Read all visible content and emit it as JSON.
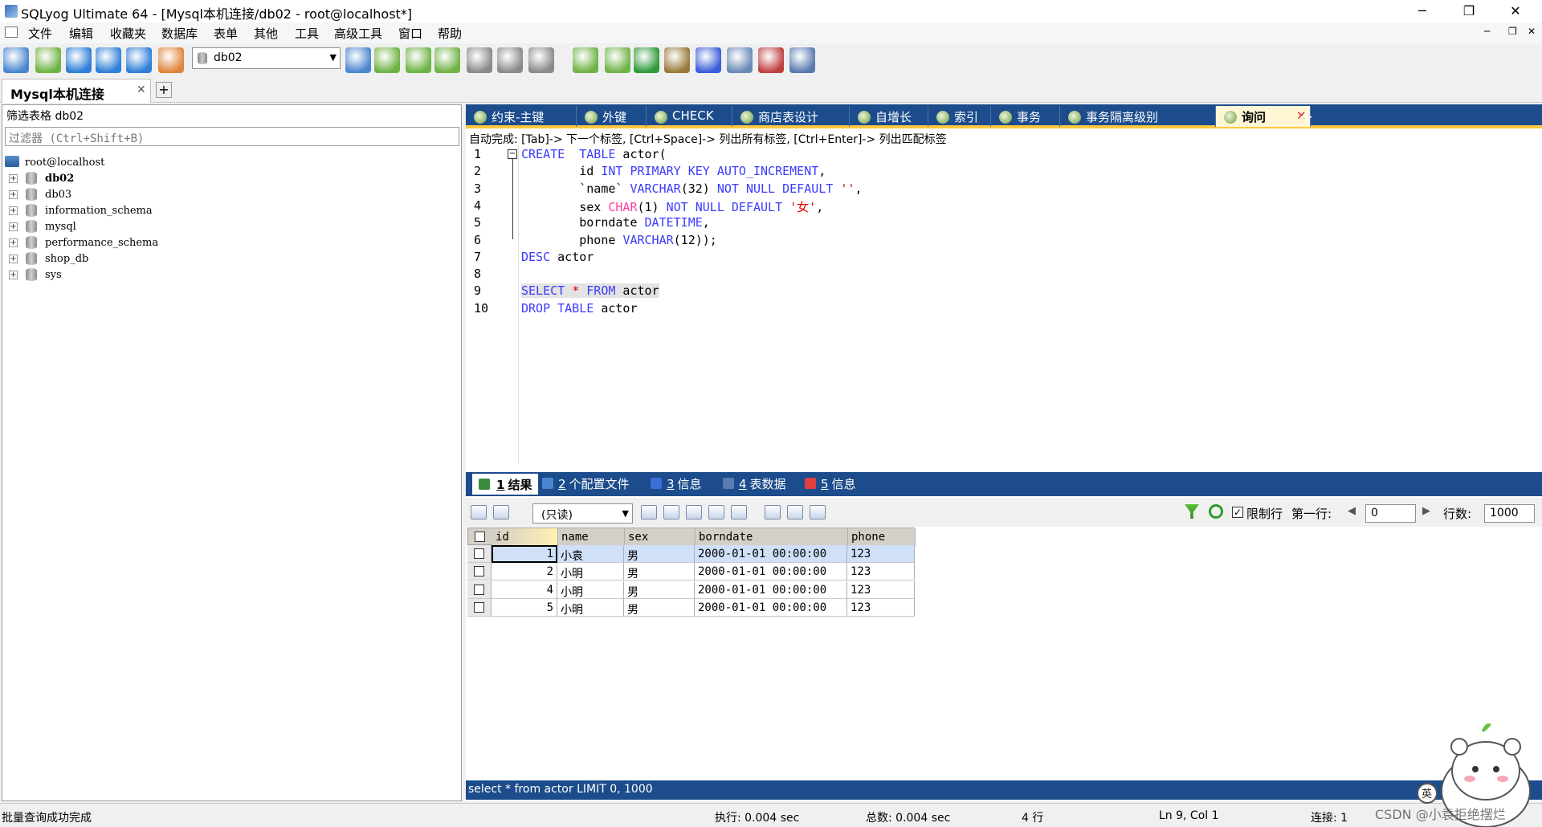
{
  "window": {
    "title": "SQLyog Ultimate 64 - [Mysql本机连接/db02 - root@localhost*]"
  },
  "menu": [
    "文件",
    "编辑",
    "收藏夹",
    "数据库",
    "表单",
    "其他",
    "工具",
    "高级工具",
    "窗口",
    "帮助"
  ],
  "toolbar": {
    "database": "db02"
  },
  "connection_tab": {
    "label": "Mysql本机连接"
  },
  "object_browser": {
    "filter_label": "筛选表格 db02",
    "filter_placeholder": "过滤器 (Ctrl+Shift+B)",
    "root": "root@localhost",
    "databases": [
      "db02",
      "db03",
      "information_schema",
      "mysql",
      "performance_schema",
      "shop_db",
      "sys"
    ],
    "selected": "db02"
  },
  "query_tabs": [
    "约束-主键",
    "外键",
    "CHECK",
    "商店表设计",
    "自增长",
    "索引",
    "事务",
    "事务隔离级别",
    "询问"
  ],
  "active_query_tab": "询问",
  "autocomplete_hint": "自动完成: [Tab]-> 下一个标签, [Ctrl+Space]-> 列出所有标签, [Ctrl+Enter]-> 列出匹配标签",
  "editor": {
    "line_numbers": [
      "1",
      "2",
      "3",
      "4",
      "5",
      "6",
      "7",
      "8",
      "9",
      "10"
    ],
    "lines": [
      [
        [
          "kw",
          "CREATE"
        ],
        [
          "",
          "  "
        ],
        [
          "kw",
          "TABLE"
        ],
        [
          "",
          " actor("
        ]
      ],
      [
        [
          "",
          "        id "
        ],
        [
          "kw",
          "INT"
        ],
        [
          "",
          " "
        ],
        [
          "kw",
          "PRIMARY KEY AUTO_INCREMENT"
        ],
        [
          "",
          ","
        ]
      ],
      [
        [
          "",
          "        `name` "
        ],
        [
          "kw",
          "VARCHAR"
        ],
        [
          "",
          "(32) "
        ],
        [
          "kw",
          "NOT NULL DEFAULT"
        ],
        [
          "",
          " "
        ],
        [
          "str",
          "''"
        ],
        [
          "",
          ","
        ]
      ],
      [
        [
          "",
          "        sex "
        ],
        [
          "chr",
          "CHAR"
        ],
        [
          "",
          "(1) "
        ],
        [
          "kw",
          "NOT NULL DEFAULT"
        ],
        [
          "",
          " "
        ],
        [
          "str",
          "'女'"
        ],
        [
          "",
          ","
        ]
      ],
      [
        [
          "",
          "        borndate "
        ],
        [
          "kw",
          "DATETIME"
        ],
        [
          "",
          ","
        ]
      ],
      [
        [
          "",
          "        phone "
        ],
        [
          "kw",
          "VARCHAR"
        ],
        [
          "",
          "(12));"
        ]
      ],
      [
        [
          "kw",
          "DESC"
        ],
        [
          "",
          " actor"
        ]
      ],
      [
        [
          "",
          ""
        ]
      ],
      [
        [
          "kw",
          "SELECT"
        ],
        [
          "",
          " "
        ],
        [
          "str",
          "*"
        ],
        [
          "",
          " "
        ],
        [
          "kw",
          "FROM"
        ],
        [
          "",
          " actor"
        ]
      ],
      [
        [
          "kw",
          "DROP"
        ],
        [
          "",
          " "
        ],
        [
          "kw",
          "TABLE"
        ],
        [
          "",
          " actor"
        ]
      ]
    ]
  },
  "result_tabs": [
    {
      "num": "1",
      "label": "结果"
    },
    {
      "num": "2",
      "label": "个配置文件"
    },
    {
      "num": "3",
      "label": "信息"
    },
    {
      "num": "4",
      "label": "表数据"
    },
    {
      "num": "5",
      "label": "信息"
    }
  ],
  "result_toolbar": {
    "mode": "(只读)",
    "limit_label": "限制行",
    "first_row_label": "第一行:",
    "first_row": "0",
    "rows_label": "行数:",
    "rows": "1000"
  },
  "result_grid": {
    "columns": [
      "id",
      "name",
      "sex",
      "borndate",
      "phone"
    ],
    "rows": [
      [
        "1",
        "小袁",
        "男",
        "2000-01-01 00:00:00",
        "123"
      ],
      [
        "2",
        "小明",
        "男",
        "2000-01-01 00:00:00",
        "123"
      ],
      [
        "4",
        "小明",
        "男",
        "2000-01-01 00:00:00",
        "123"
      ],
      [
        "5",
        "小明",
        "男",
        "2000-01-01 00:00:00",
        "123"
      ]
    ]
  },
  "sql_footer": "select * from actor LIMIT 0, 1000",
  "status": {
    "message": "批量查询成功完成",
    "exec": "执行: 0.004 sec",
    "total": "总数: 0.004 sec",
    "rows": "4 行",
    "position": "Ln 9, Col 1",
    "connections": "连接: 1",
    "watermark": "CSDN @小袁拒绝摆烂"
  },
  "colors": {
    "tab_bar": "#1c4c8c",
    "accent": "#ffc83d",
    "keyword": "#3b3bff",
    "string": "#e00000"
  }
}
